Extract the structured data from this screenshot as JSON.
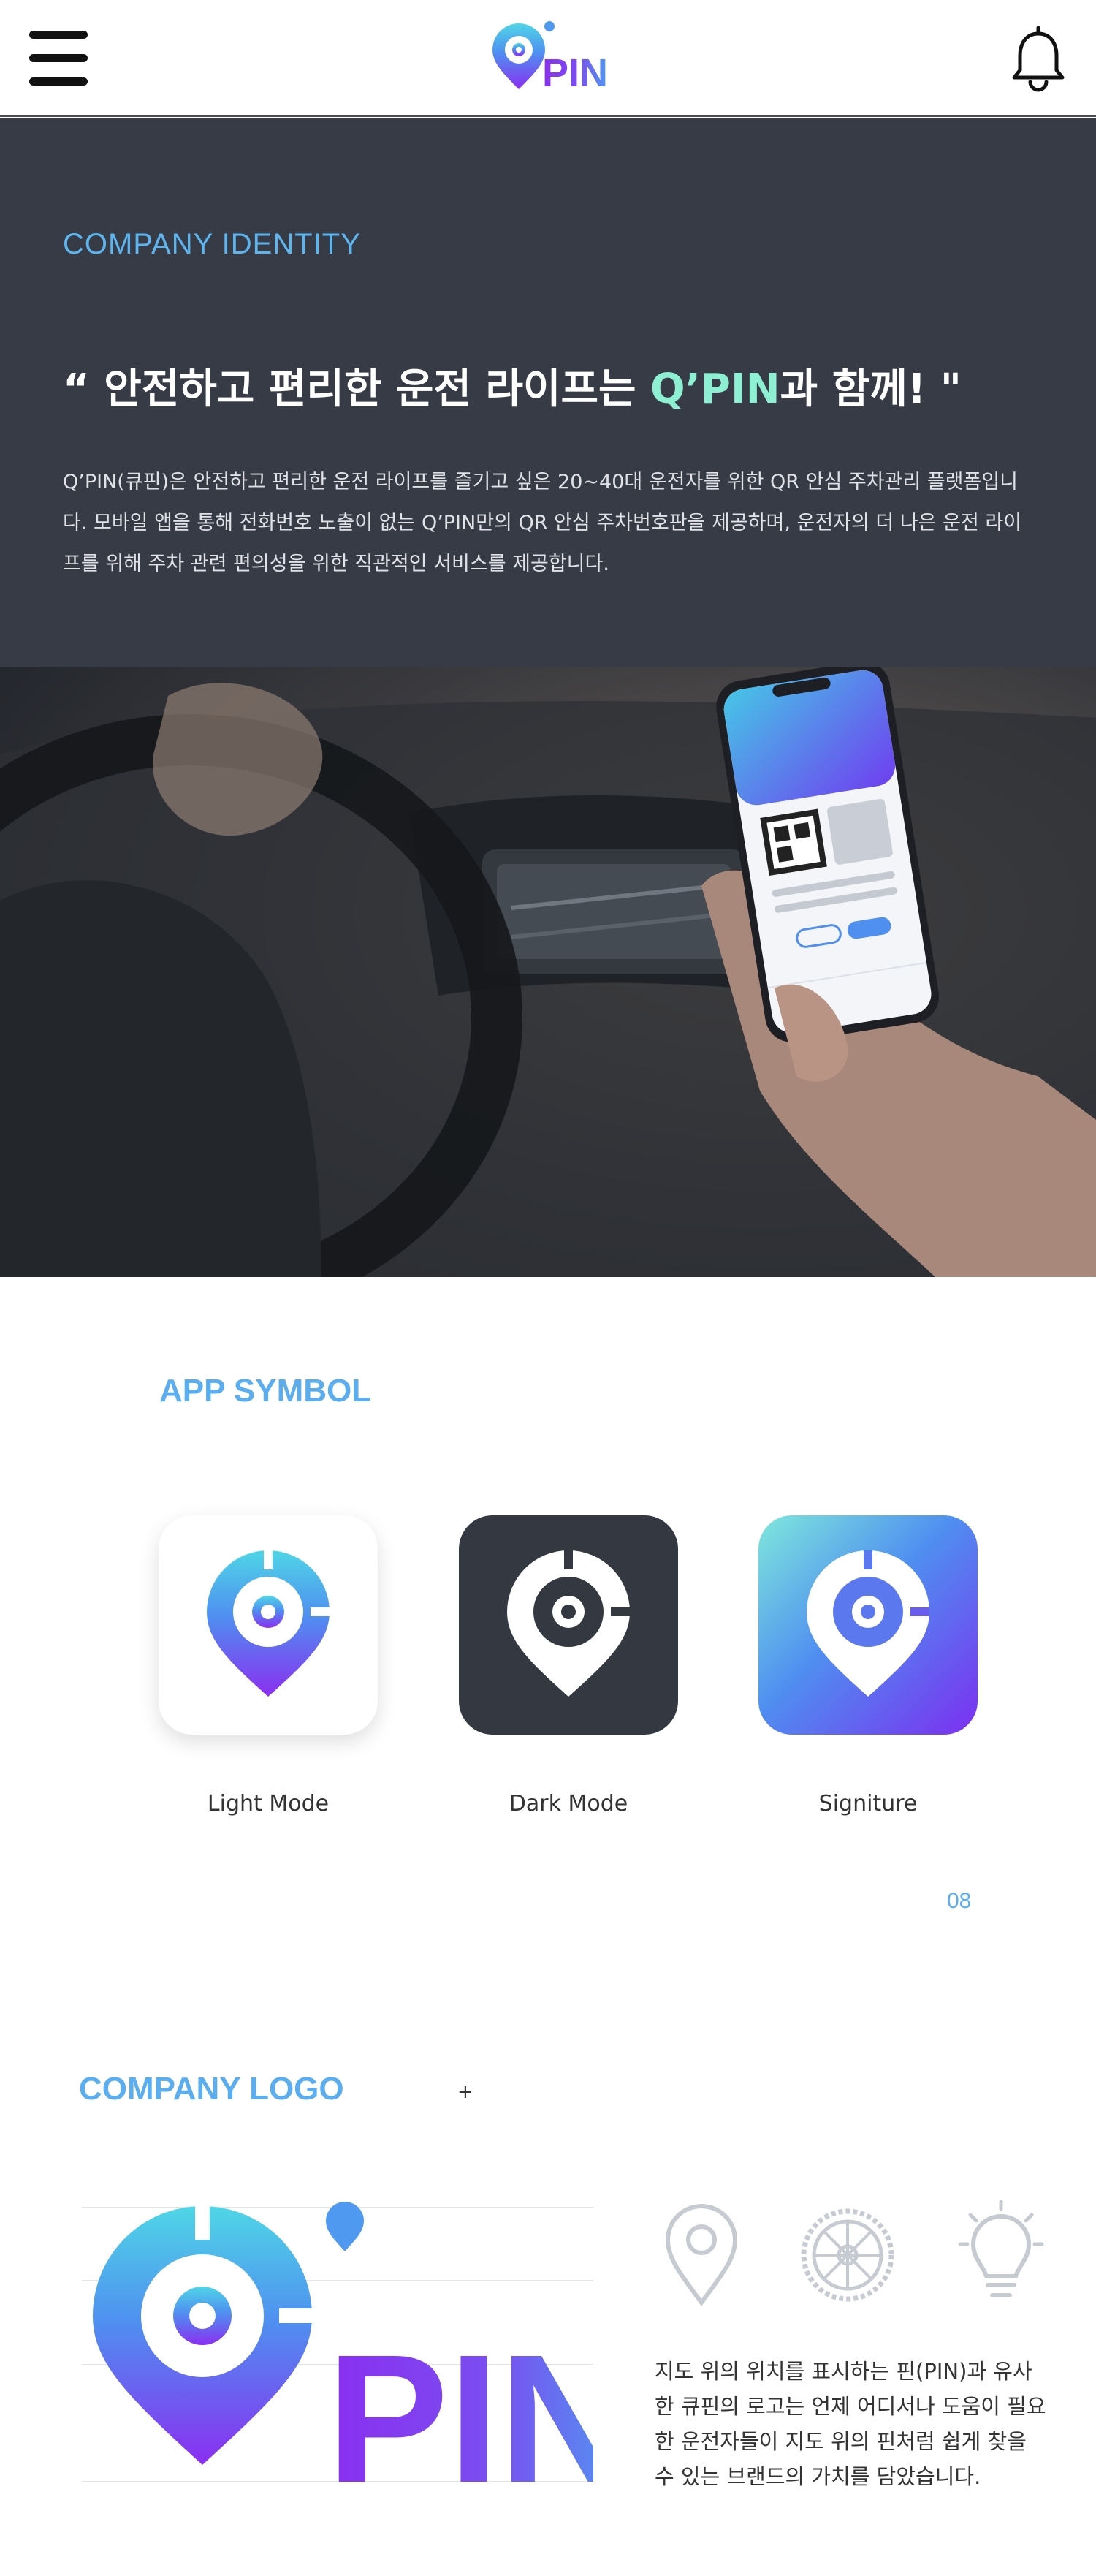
{
  "header": {
    "menu_icon": "hamburger-icon",
    "logo_text": "PIN",
    "logo_mark": "Q",
    "bell_icon": "bell-icon"
  },
  "identity": {
    "label": "COMPANY IDENTITY",
    "slogan_prefix": "“ 안전하고 편리한 운전 라이프는 ",
    "slogan_accent": "Q’PIN",
    "slogan_suffix": "과 함께! \"",
    "description": "Q’PIN(큐핀)은 안전하고 편리한 운전 라이프를 즐기고 싶은 20~40대 운전자를 위한 QR 안심 주차관리 플랫폼입니다. 모바일 앱을 통해 전화번호 노출이 없는 Q’PIN만의 QR 안심 주차번호판을 제공하며, 운전자의 더 나은 운전 라이프를 위해 주차 관련 편의성을 위한 직관적인 서비스를 제공합니다."
  },
  "photo": {
    "subject": "driver holding smartphone showing Q'PIN app inside car"
  },
  "app_symbol": {
    "title": "APP SYMBOL",
    "icons": [
      {
        "label": "Light Mode"
      },
      {
        "label": "Dark Mode"
      },
      {
        "label": "Signiture"
      }
    ],
    "page_number": "08"
  },
  "company_logo": {
    "title": "COMPANY LOGO",
    "plus": "+",
    "wordmark": "PIN",
    "feature_icons": [
      "map-pin-icon",
      "tire-icon",
      "lightbulb-icon"
    ],
    "description": "지도 위의 위치를 표시하는 핀(PIN)과 유사한 큐핀의 로고는 언제 어디서나 도움이 필요한 운전자들이 지도 위의 핀처럼 쉽게 찾을 수 있는 브랜드의 가치를 담았습니다."
  },
  "colors": {
    "accent_blue": "#5aaef0",
    "accent_mint": "#8ef0d2",
    "dark_bg": "#363b45",
    "brand_purple": "#7b2ff0"
  }
}
